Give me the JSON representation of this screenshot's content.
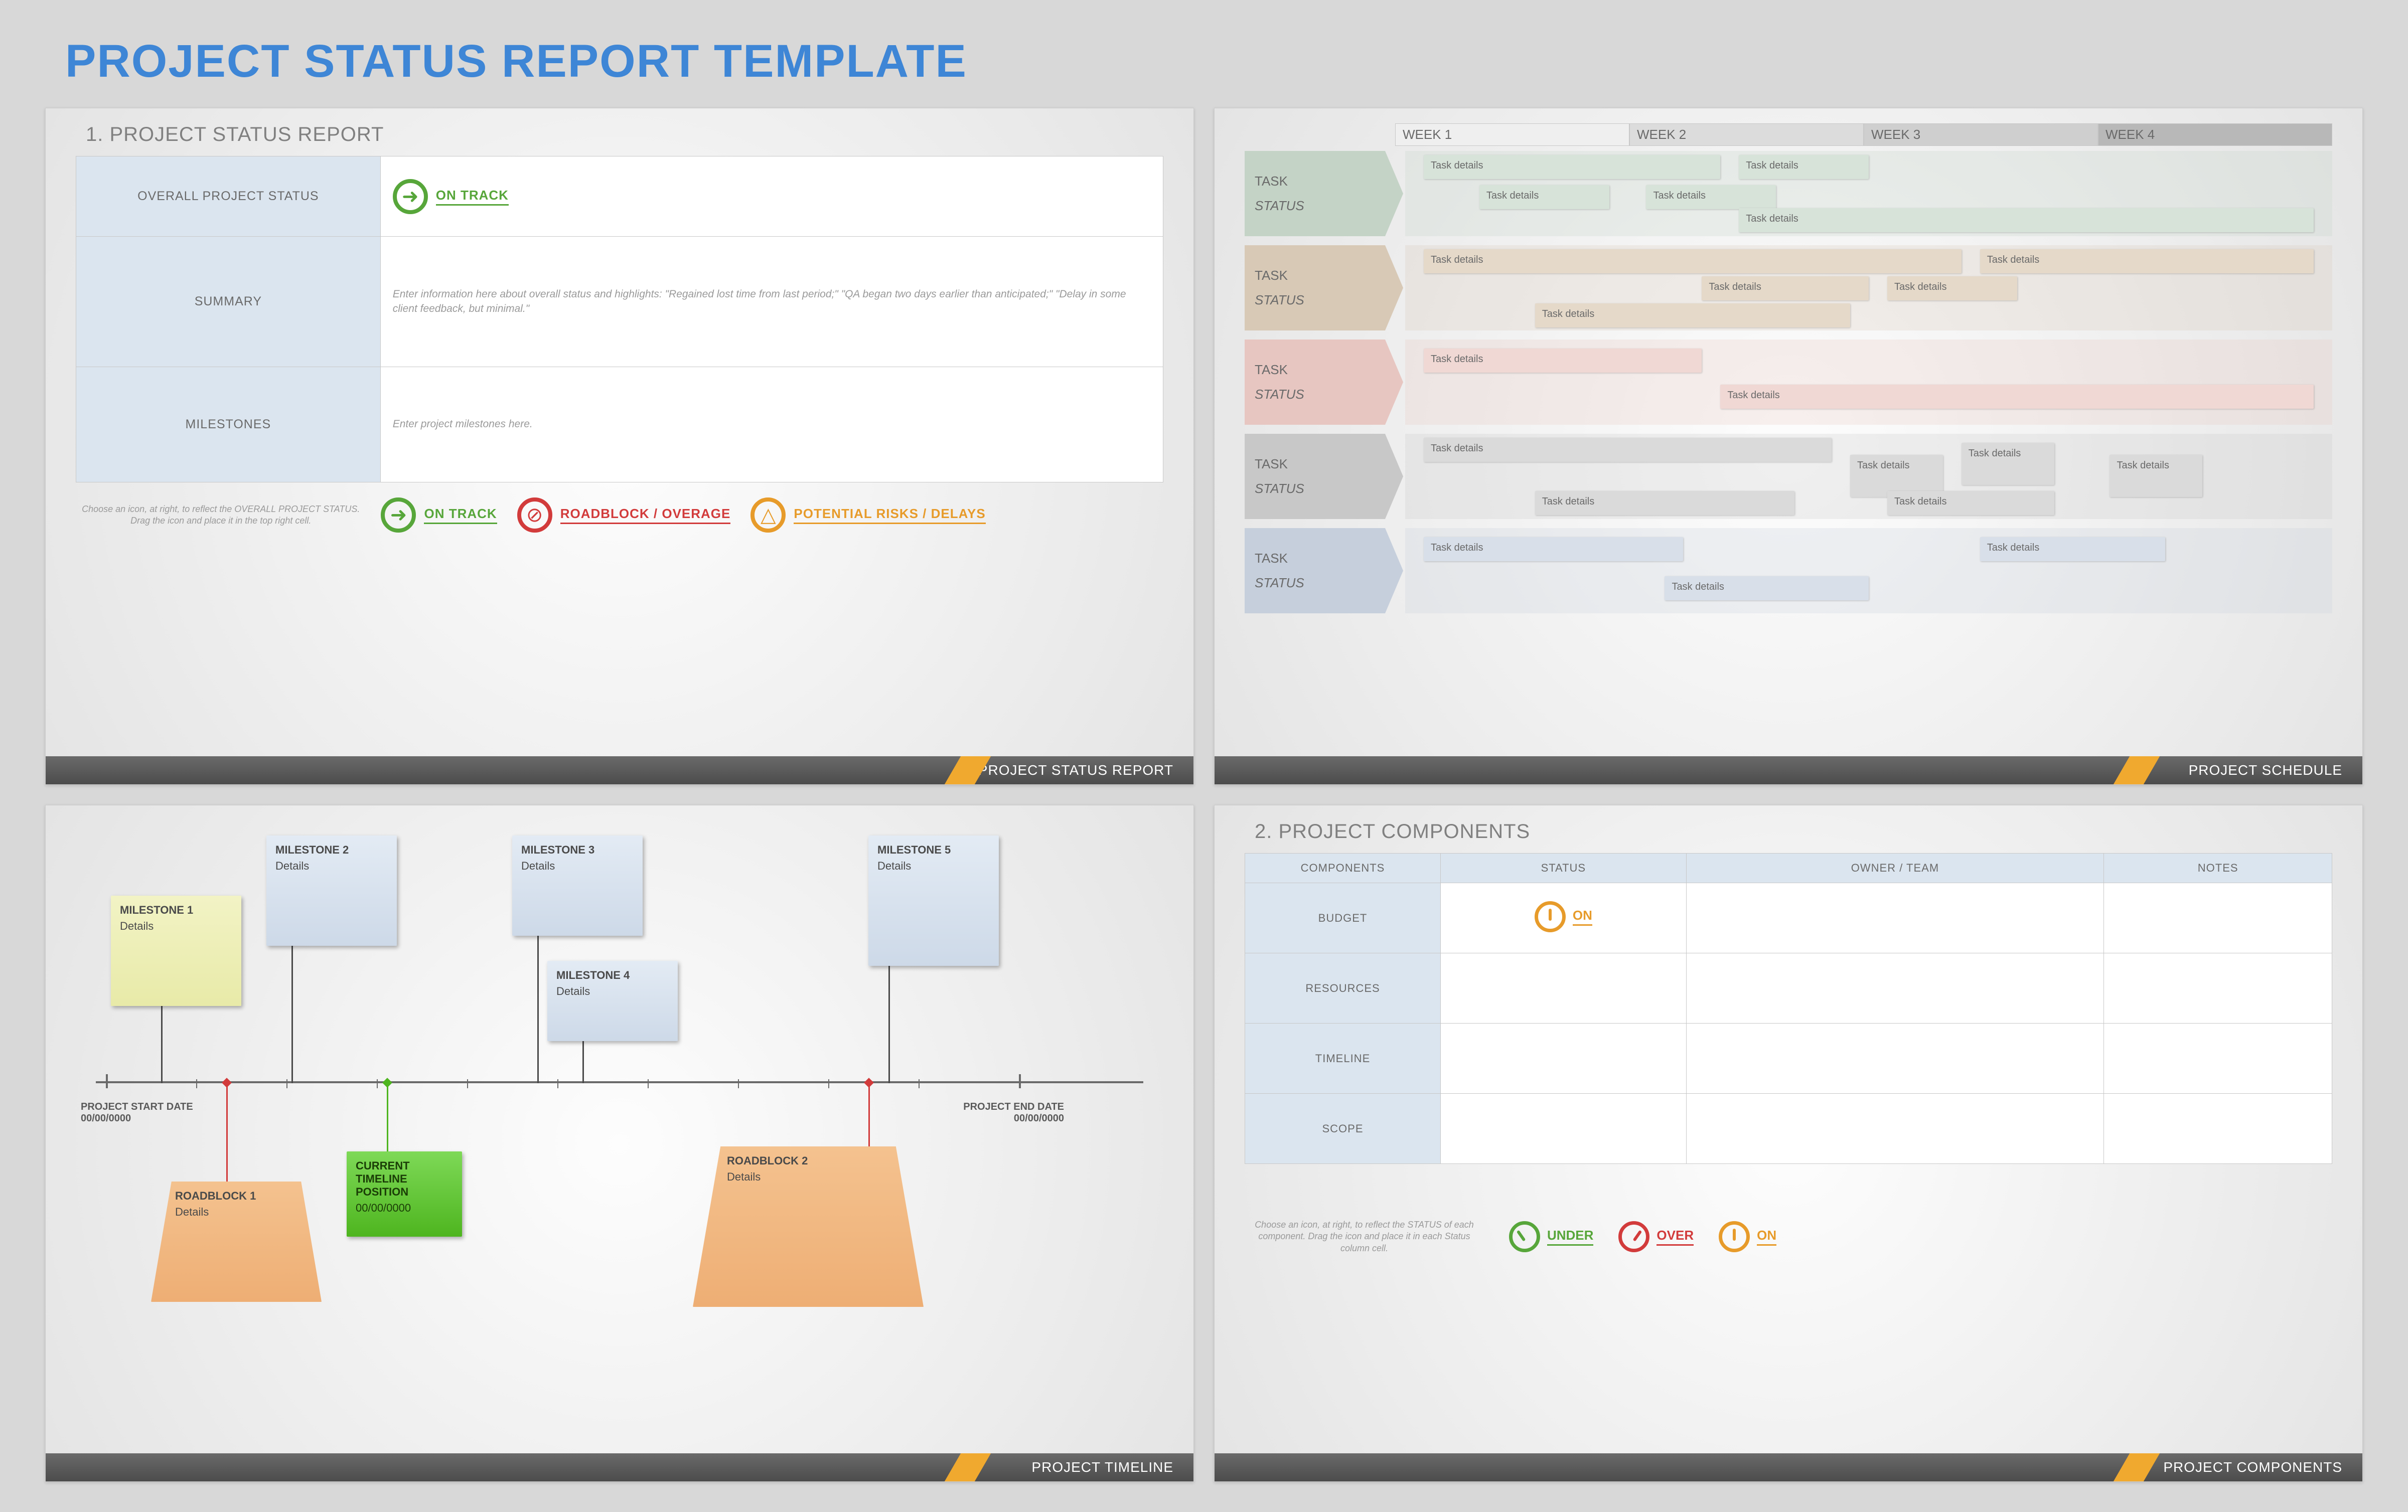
{
  "title": "PROJECT STATUS REPORT TEMPLATE",
  "panel1": {
    "heading": "1. PROJECT STATUS REPORT",
    "rows": {
      "overall_label": "OVERALL PROJECT STATUS",
      "summary_label": "SUMMARY",
      "summary_placeholder": "Enter information here about overall status and highlights: \"Regained lost time from last period;\" \"QA began two days earlier than anticipated;\" \"Delay in some client feedback, but minimal.\"",
      "milestones_label": "MILESTONES",
      "milestones_placeholder": "Enter project milestones here."
    },
    "legend_hint": "Choose an icon, at right, to reflect the OVERALL PROJECT STATUS. Drag the icon and place it in the top right cell.",
    "legend": {
      "on_track": "ON TRACK",
      "roadblock": "ROADBLOCK / OVERAGE",
      "risks": "POTENTIAL RISKS / DELAYS"
    },
    "footer": "PROJECT STATUS REPORT"
  },
  "panel2": {
    "weeks": [
      "WEEK 1",
      "WEEK 2",
      "WEEK 3",
      "WEEK 4"
    ],
    "lane": {
      "task": "TASK",
      "status": "STATUS"
    },
    "bar_text": "Task details",
    "footer": "PROJECT SCHEDULE"
  },
  "panel3": {
    "start": {
      "label": "PROJECT START DATE",
      "date": "00/00/0000"
    },
    "end": {
      "label": "PROJECT END DATE",
      "date": "00/00/0000"
    },
    "milestones": [
      {
        "title": "MILESTONE 1",
        "detail": "Details"
      },
      {
        "title": "MILESTONE 2",
        "detail": "Details"
      },
      {
        "title": "MILESTONE 3",
        "detail": "Details"
      },
      {
        "title": "MILESTONE 4",
        "detail": "Details"
      },
      {
        "title": "MILESTONE 5",
        "detail": "Details"
      }
    ],
    "current": {
      "title": "CURRENT TIMELINE POSITION",
      "date": "00/00/0000"
    },
    "roadblocks": [
      {
        "title": "ROADBLOCK 1",
        "detail": "Details"
      },
      {
        "title": "ROADBLOCK 2",
        "detail": "Details"
      }
    ],
    "footer": "PROJECT TIMELINE"
  },
  "panel4": {
    "heading": "2. PROJECT COMPONENTS",
    "headers": [
      "COMPONENTS",
      "STATUS",
      "OWNER / TEAM",
      "NOTES"
    ],
    "rows": [
      "BUDGET",
      "RESOURCES",
      "TIMELINE",
      "SCOPE"
    ],
    "status_value": "ON",
    "legend_hint": "Choose an icon, at right, to reflect the STATUS of each component. Drag the icon and place it in each Status column cell.",
    "legend": {
      "under": "UNDER",
      "over": "OVER",
      "on": "ON"
    },
    "footer": "PROJECT COMPONENTS"
  }
}
